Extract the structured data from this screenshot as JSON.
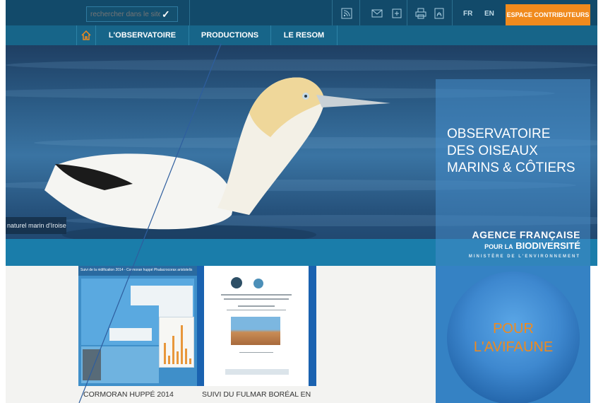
{
  "search": {
    "placeholder": "rechercher dans le site..."
  },
  "toolbar": {
    "icons": [
      "rss-icon",
      "mail-icon",
      "plus-icon",
      "print-icon",
      "pdf-icon"
    ],
    "languages": [
      "FR",
      "EN"
    ],
    "contributors_label": "ESPACE CONTRIBUTEURS"
  },
  "nav": {
    "items": [
      {
        "label": "L'OBSERVATOIRE"
      },
      {
        "label": "PRODUCTIONS"
      },
      {
        "label": "LE RESOM"
      }
    ]
  },
  "hero": {
    "credit": "naturel marin d'Iroise",
    "title_line1": "OBSERVATOIRE",
    "title_line2": "DES OISEAUX",
    "title_line3": "MARINS & CÔTIERS",
    "agency_line1": "AGENCE FRANÇAISE",
    "agency_pour": "POUR LA",
    "agency_biodiv": "BIODIVERSITÉ",
    "ministry": "MINISTÈRE DE L'ENVIRONNEMENT",
    "globe_line1": "POUR",
    "globe_line2": "L'AVIFAUNE"
  },
  "cards": [
    {
      "title": "CORMORAN HUPPÉ 2014",
      "header": "Suivi de la nidification 2014 - Cormoran huppé Phalacrocorax aristotelis"
    },
    {
      "title": "SUIVI DU FULMAR BORÉAL EN"
    }
  ],
  "colors": {
    "topbar": "#124a6a",
    "navbar": "#176589",
    "accent_orange": "#f08a1d"
  }
}
